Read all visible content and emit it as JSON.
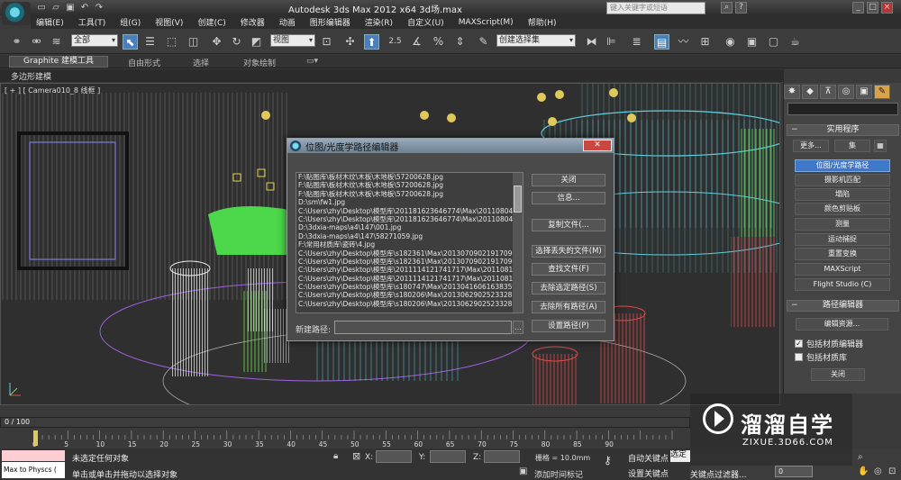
{
  "app": {
    "title": "Autodesk 3ds Max  2012 x64     3d场.max",
    "search_placeholder": "键入关键字或短语"
  },
  "menu": [
    "编辑(E)",
    "工具(T)",
    "组(G)",
    "视图(V)",
    "创建(C)",
    "修改器",
    "动画",
    "图形编辑器",
    "渲染(R)",
    "自定义(U)",
    "MAXScript(M)",
    "帮助(H)"
  ],
  "toolbar": {
    "selection_filter": "全部",
    "reference_coord": "视图",
    "named_selection": "创建选择集",
    "angle_snap": "2.5",
    "percent_snap": "%"
  },
  "ribbon": {
    "tabs": [
      "Graphite 建模工具",
      "自由形式",
      "选择",
      "对象绘制"
    ],
    "sub_label": "多边形建模"
  },
  "viewport": {
    "label": "[ + ] [ Camera010_8 线框 ]"
  },
  "command_panel": {
    "utilities_header": "实用程序",
    "more_button": "更多...",
    "sets_button": "集",
    "utilities": [
      {
        "label": "位图/光度学路径",
        "selected": true
      },
      {
        "label": "摄影机匹配",
        "selected": false
      },
      {
        "label": "塌陷",
        "selected": false
      },
      {
        "label": "颜色剪贴板",
        "selected": false
      },
      {
        "label": "测量",
        "selected": false
      },
      {
        "label": "运动捕捉",
        "selected": false
      },
      {
        "label": "重置变换",
        "selected": false
      },
      {
        "label": "MAXScript",
        "selected": false
      },
      {
        "label": "Flight Studio (C)",
        "selected": false
      }
    ],
    "path_editor_header": "路径编辑器",
    "edit_resources_button": "编辑资源...",
    "include_material_editor": {
      "label": "包括材质编辑器",
      "checked": true
    },
    "include_material_library": {
      "label": "包括材质库",
      "checked": false
    },
    "close_button": "关闭"
  },
  "dialog": {
    "title": "位图/光度学路径编辑器",
    "paths": [
      "F:\\贴图库\\板材木纹\\木板\\木地板\\57200628.jpg",
      "F:\\贴图库\\板材木纹\\木板\\木地板\\57200628.jpg",
      "F:\\贴图库\\板材木纹\\木板\\木地板\\57200628.jpg",
      "D:\\sm\\fw1.jpg",
      "C:\\Users\\zhy\\Desktop\\模型库\\201181623646774\\Max\\2011080418",
      "C:\\Users\\zhy\\Desktop\\模型库\\201181623646774\\Max\\2011080418",
      "D:\\3dxia-maps\\a4\\147\\001.jpg",
      "D:\\3dxia-maps\\a4\\147\\58271059.jpg",
      "F:\\常用材质库\\瓷砖\\4.jpg",
      "C:\\Users\\zhy\\Desktop\\模型库\\s182361\\Max\\2013070902191709640",
      "C:\\Users\\zhy\\Desktop\\模型库\\s182361\\Max\\2013070902191709640",
      "C:\\Users\\zhy\\Desktop\\模型库\\2011114121741717\\Max\\20110819",
      "C:\\Users\\zhy\\Desktop\\模型库\\2011114121741717\\Max\\20110819",
      "C:\\Users\\zhy\\Desktop\\模型库\\s180747\\Max\\2013041606163835997",
      "C:\\Users\\zhy\\Desktop\\模型库\\s180206\\Max\\2013062902523328",
      "C:\\Users\\zhy\\Desktop\\模型库\\s180206\\Max\\2013062902523328"
    ],
    "buttons": [
      "关闭",
      "信息...",
      "复制文件(...",
      "选择丢失的文件(M)",
      "查找文件(F)",
      "去除选定路径(S)",
      "去除所有路径(A)",
      "设置路径(P)"
    ],
    "new_path_label": "新建路径:",
    "new_path_value": ""
  },
  "timeline": {
    "frame_display": "0 / 100",
    "ticks": [
      "0",
      "5",
      "10",
      "15",
      "20",
      "25",
      "30",
      "35",
      "40",
      "45",
      "50",
      "55",
      "60",
      "65",
      "70",
      "75",
      "80",
      "85",
      "90"
    ]
  },
  "status": {
    "maxscript_text": "Max to Physcs (",
    "line1": "未选定任何对象",
    "line2": "单击或单击并拖动以选择对象",
    "x_label": "X:",
    "y_label": "Y:",
    "z_label": "Z:",
    "grid": "栅格 = 10.0mm",
    "add_time_tag": "添加时间标记",
    "auto_key": "自动关键点",
    "auto_key_dropdown": "选定",
    "set_key": "设置关键点",
    "key_filters": "关键点过滤器...",
    "current_frame": "0"
  },
  "watermark": {
    "title": "溜溜自学",
    "url": "ZIXUE.3D66.COM"
  },
  "colors": {
    "accent_blue": "#3f78c8",
    "wire_cyan": "#5fd0e0",
    "wire_green": "#6fe04a",
    "wire_red": "#e04a4a",
    "wire_yellow": "#e0d04a"
  }
}
